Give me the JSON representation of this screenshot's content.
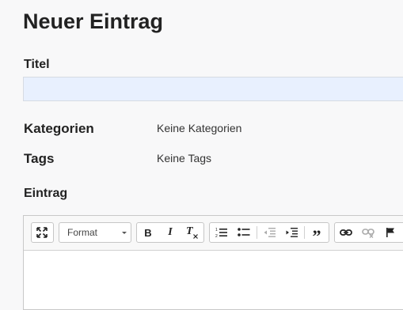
{
  "page": {
    "title": "Neuer Eintrag"
  },
  "form": {
    "title_label": "Titel",
    "title_value": "",
    "categories_label": "Kategorien",
    "categories_value": "Keine Kategorien",
    "tags_label": "Tags",
    "tags_value": "Keine Tags",
    "entry_label": "Eintrag"
  },
  "toolbar": {
    "format_label": "Format",
    "bold_label": "B",
    "italic_label": "I",
    "remove_format_label": "T",
    "blockquote_label": "”"
  }
}
